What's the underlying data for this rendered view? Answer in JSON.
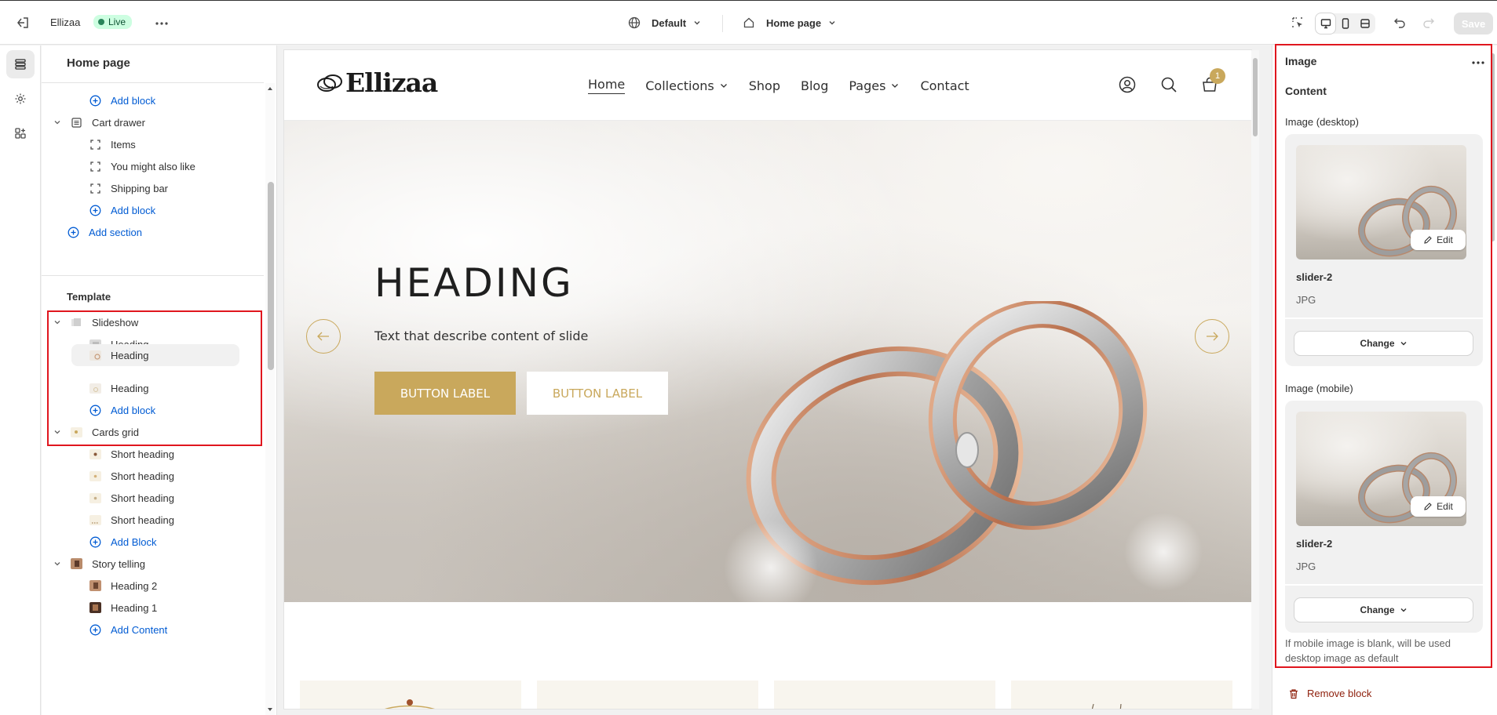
{
  "topbar": {
    "store_name": "Ellizaa",
    "live_label": "Live",
    "theme_select": "Default",
    "page_select": "Home page",
    "save_label": "Save"
  },
  "sidebar": {
    "title": "Home page",
    "template_label": "Template",
    "rows": {
      "add_block_1": "Add block",
      "cart_drawer": "Cart drawer",
      "items": "Items",
      "you_might": "You might also like",
      "shipping_bar": "Shipping bar",
      "add_block_2": "Add block",
      "add_section": "Add section",
      "slideshow": "Slideshow",
      "heading_1": "Heading",
      "heading_2": "Heading",
      "heading_3": "Heading",
      "add_block_3": "Add block",
      "cards_grid": "Cards grid",
      "short_1": "Short heading",
      "short_2": "Short heading",
      "short_3": "Short heading",
      "short_4": "Short heading",
      "add_block_4": "Add Block",
      "story_telling": "Story telling",
      "heading_st_2": "Heading 2",
      "heading_st_1": "Heading 1",
      "add_content": "Add Content"
    }
  },
  "preview": {
    "logo_text": "Ellizaa",
    "nav": {
      "home": "Home",
      "collections": "Collections",
      "shop": "Shop",
      "blog": "Blog",
      "pages": "Pages",
      "contact": "Contact"
    },
    "cart_count": "1",
    "hero": {
      "heading": "HEADING",
      "text": "Text that describe content of slide",
      "button_1": "BUTTON LABEL",
      "button_2": "BUTTON LABEL"
    }
  },
  "panel": {
    "title": "Image",
    "subtitle": "Content",
    "desktop_label": "Image (desktop)",
    "mobile_label": "Image (mobile)",
    "desktop_image": {
      "name": "slider-2",
      "type": "JPG",
      "edit": "Edit",
      "change": "Change"
    },
    "mobile_image": {
      "name": "slider-2",
      "type": "JPG",
      "edit": "Edit",
      "change": "Change"
    },
    "help_text": "If mobile image is blank, will be used desktop image as default",
    "remove_label": "Remove block"
  },
  "colors": {
    "accent_gold": "#c9a85c",
    "link_blue": "#005bd3",
    "highlight_red": "#e0161e",
    "live_green": "#29845a",
    "remove_red": "#8e1f0b"
  }
}
